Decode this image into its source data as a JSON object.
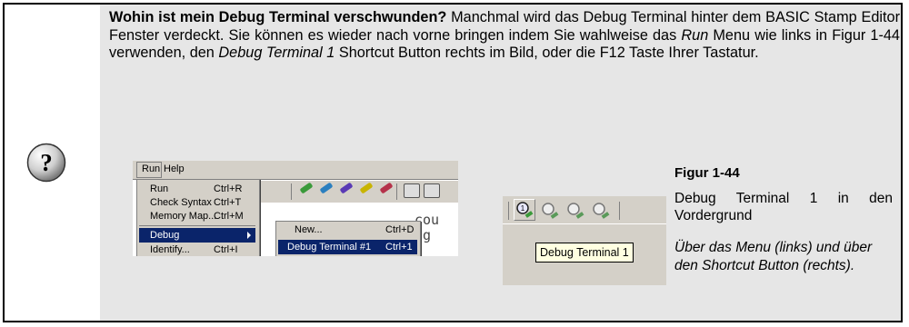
{
  "tip": {
    "title": "Wohin ist mein Debug Terminal verschwunden?",
    "text_1": " Manchmal wird das Debug Terminal hinter dem BASIC Stamp Editor Fenster verdeckt.  Sie können es wieder nach vorne bringen indem Sie wahlweise das ",
    "run_word": "Run",
    "text_2": " Menu wie links in Figur 1-44 verwenden, den ",
    "shortcut_name": "Debug Terminal 1",
    "text_3": " Shortcut Button rechts im Bild, oder die F12 Taste Ihrer Tastatur."
  },
  "icon": "question-mark-icon",
  "ide_menu": {
    "menubar": [
      "Run",
      "Help"
    ],
    "run_menu": [
      {
        "label": "Run",
        "shortcut": "Ctrl+R"
      },
      {
        "label": "Check Syntax",
        "shortcut": "Ctrl+T"
      },
      {
        "label": "Memory Map...",
        "shortcut": "Ctrl+M"
      },
      {
        "label": "Debug",
        "shortcut": ""
      },
      {
        "label": "Identify...",
        "shortcut": "Ctrl+I"
      }
    ],
    "debug_submenu": [
      {
        "label": "New...",
        "shortcut": "Ctrl+D"
      },
      {
        "label": "Debug Terminal #1",
        "shortcut": "Ctrl+1"
      }
    ],
    "background_text_1": "cou",
    "background_text_2": "ug"
  },
  "shortcut_shot": {
    "tooltip": "Debug Terminal 1"
  },
  "figure": {
    "title": "Figur 1-44",
    "description": "Debug Terminal 1 in den Vordergrund",
    "note": "Über das Menu (links) und über den Shortcut Button (rechts)."
  },
  "colors": {
    "background": "#e6e6e6",
    "menu_highlight": "#0a246a",
    "tooltip_bg": "#ffffe1"
  }
}
